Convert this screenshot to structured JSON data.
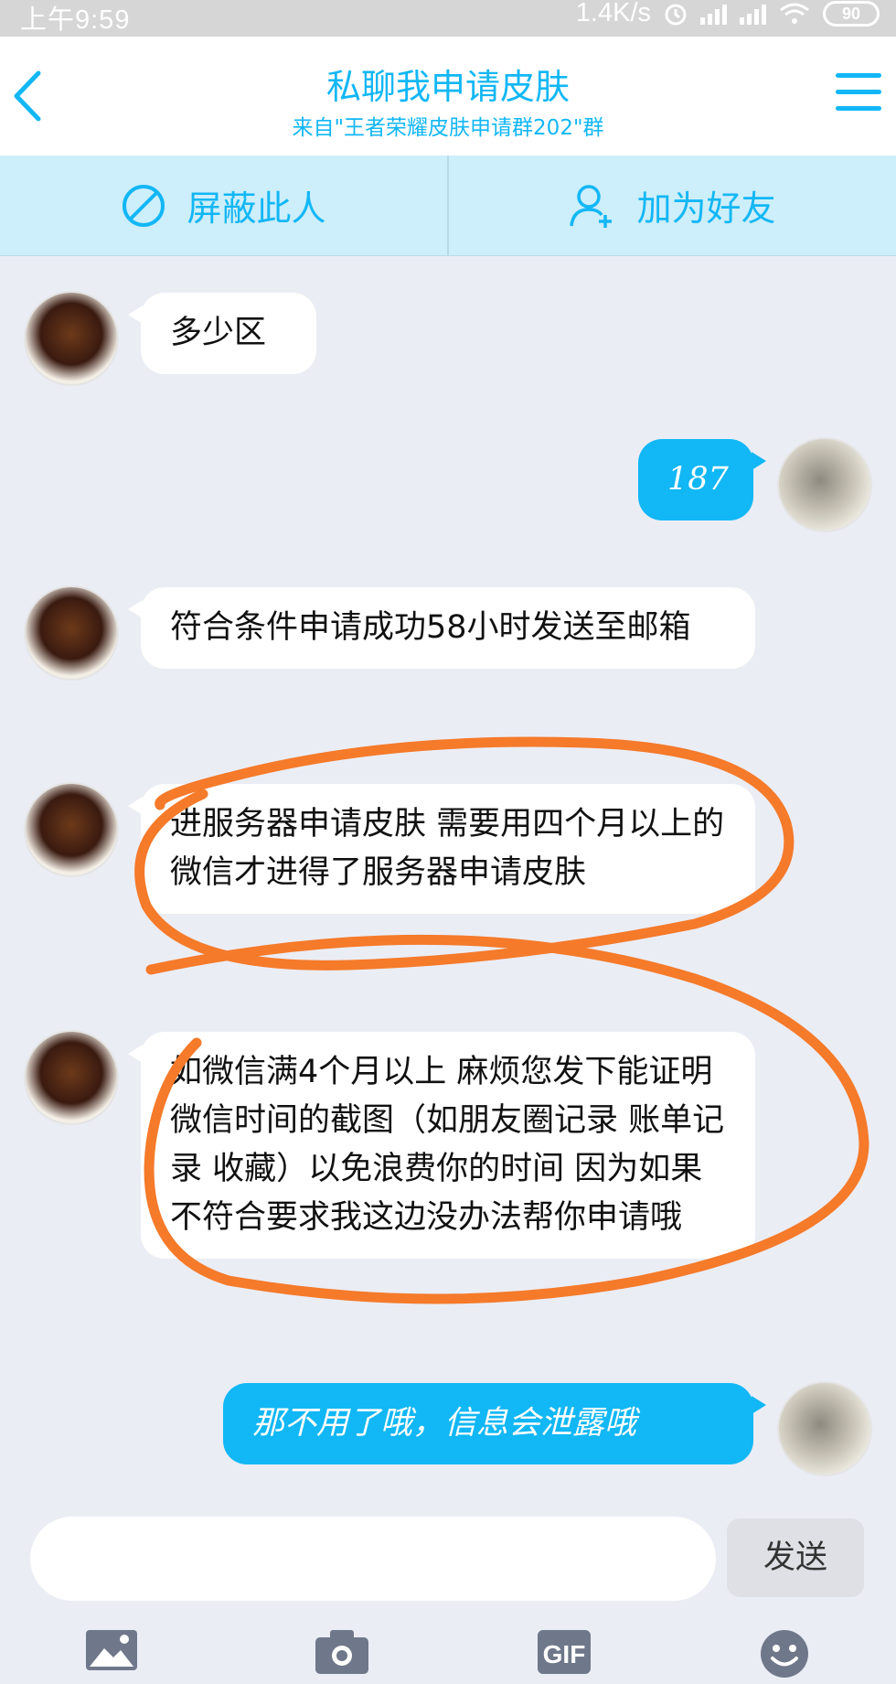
{
  "status_bar": {
    "time": "上午9:59",
    "net_speed": "1.4K/s",
    "battery": "90"
  },
  "header": {
    "title": "私聊我申请皮肤",
    "subtitle": "来自\"王者荣耀皮肤申请群202\"群"
  },
  "actions": {
    "block": "屏蔽此人",
    "add_friend": "加为好友"
  },
  "messages": [
    {
      "from": "other",
      "text": "多少区"
    },
    {
      "from": "self",
      "text": "187"
    },
    {
      "from": "other",
      "text": "符合条件申请成功58小时发送至邮箱"
    },
    {
      "from": "other",
      "text": "进服务器申请皮肤 需要用四个月以上的微信才进得了服务器申请皮肤"
    },
    {
      "from": "other",
      "text": "如微信满4个月以上 麻烦您发下能证明微信时间的截图（如朋友圈记录 账单记录 收藏）以免浪费你的时间 因为如果不符合要求我这边没办法帮你申请哦"
    },
    {
      "from": "self",
      "text": "那不用了哦，信息会泄露哦"
    }
  ],
  "composer": {
    "placeholder": "",
    "send_label": "发送",
    "gif_label": "GIF"
  },
  "colors": {
    "accent": "#12b7f5",
    "annotation": "#f57a2a"
  },
  "icons": [
    "back-icon",
    "menu-icon",
    "block-icon",
    "add-friend-icon",
    "image-icon",
    "camera-icon",
    "gif-icon",
    "emoji-icon"
  ]
}
